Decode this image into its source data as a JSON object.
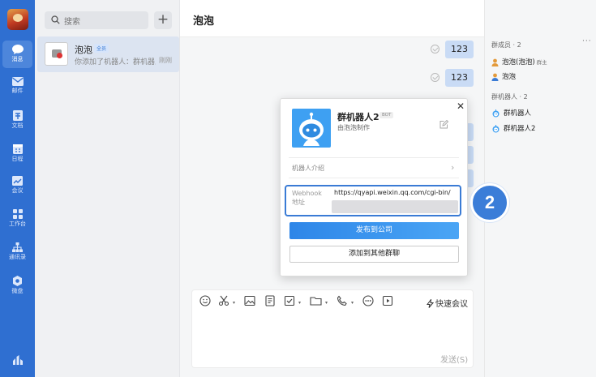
{
  "nav": {
    "items": [
      {
        "label": "消息",
        "icon": "chat-bubble-icon",
        "active": true
      },
      {
        "label": "邮件",
        "icon": "mail-icon"
      },
      {
        "label": "文档",
        "icon": "document-icon"
      },
      {
        "label": "日程",
        "icon": "calendar-icon"
      },
      {
        "label": "会议",
        "icon": "meeting-icon"
      },
      {
        "label": "工作台",
        "icon": "grid-icon"
      },
      {
        "label": "通讯录",
        "icon": "org-chart-icon"
      },
      {
        "label": "微盘",
        "icon": "cloud-drive-icon"
      }
    ]
  },
  "list": {
    "search_placeholder": "搜索",
    "conversations": [
      {
        "name": "泡泡",
        "badge": "全员",
        "preview": "你添加了机器人：群机器人...",
        "time": "刚刚"
      }
    ]
  },
  "chat": {
    "title": "泡泡",
    "messages": [
      "123",
      "123"
    ],
    "composer": {
      "quick_meeting": "快速会议",
      "send": "发送(S)"
    }
  },
  "members": {
    "section_title": "群成员 · 2",
    "more": "···",
    "people": [
      {
        "name": "泡泡(泡泡)",
        "tag": "群主"
      },
      {
        "name": "泡泡",
        "tag": ""
      }
    ],
    "bots_title": "群机器人 · 2",
    "bots": [
      {
        "name": "群机器人"
      },
      {
        "name": "群机器人2"
      }
    ]
  },
  "card": {
    "close": "✕",
    "bot_name": "群机器人2",
    "bot_tag": "BOT",
    "bot_sub": "由泡泡制作",
    "intro_label": "机器人介绍",
    "intro_chevron": "›",
    "webhook_label": "Webhook 地址",
    "webhook_url": "https://qyapi.weixin.qq.com/cgi-bin/",
    "publish_label": "发布到公司",
    "add_group_label": "添加到其他群聊"
  },
  "annotation": {
    "step": "2"
  },
  "colors": {
    "rail": "#2F6FD1",
    "accent": "#3A7BD5",
    "bubble": "#C9DBF5"
  }
}
